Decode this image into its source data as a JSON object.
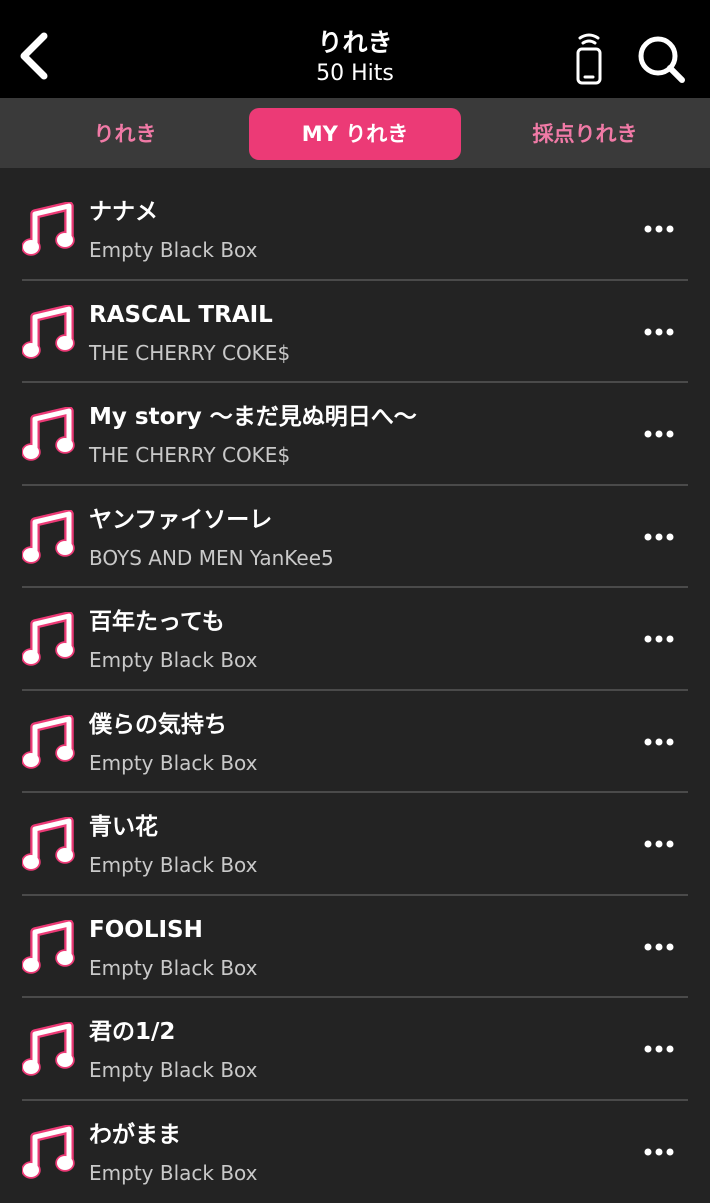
{
  "header": {
    "title": "りれき",
    "subtitle": "50 Hits",
    "back_icon": "chevron-left-icon",
    "remote_icon": "remote-control-icon",
    "search_icon": "search-icon"
  },
  "tabs": [
    {
      "label": "りれき",
      "active": false
    },
    {
      "label": "MY りれき",
      "active": true
    },
    {
      "label": "採点りれき",
      "active": false
    }
  ],
  "colors": {
    "accent": "#ec3a76",
    "tab_text": "#f07aa6",
    "background": "#232323",
    "header": "#000000",
    "tabbar": "#3a3a3a"
  },
  "songs": [
    {
      "title": "ナナメ",
      "artist": "Empty Black Box"
    },
    {
      "title": "RASCAL TRAIL",
      "artist": "THE CHERRY COKE$"
    },
    {
      "title": "My story 〜まだ見ぬ明日へ〜",
      "artist": "THE CHERRY COKE$"
    },
    {
      "title": "ヤンファイソーレ",
      "artist": "BOYS AND MEN YanKee5"
    },
    {
      "title": "百年たっても",
      "artist": "Empty Black Box"
    },
    {
      "title": "僕らの気持ち",
      "artist": "Empty Black Box"
    },
    {
      "title": "青い花",
      "artist": "Empty Black Box"
    },
    {
      "title": "FOOLISH",
      "artist": "Empty Black Box"
    },
    {
      "title": "君の1/2",
      "artist": "Empty Black Box"
    },
    {
      "title": "わがまま",
      "artist": "Empty Black Box"
    }
  ]
}
